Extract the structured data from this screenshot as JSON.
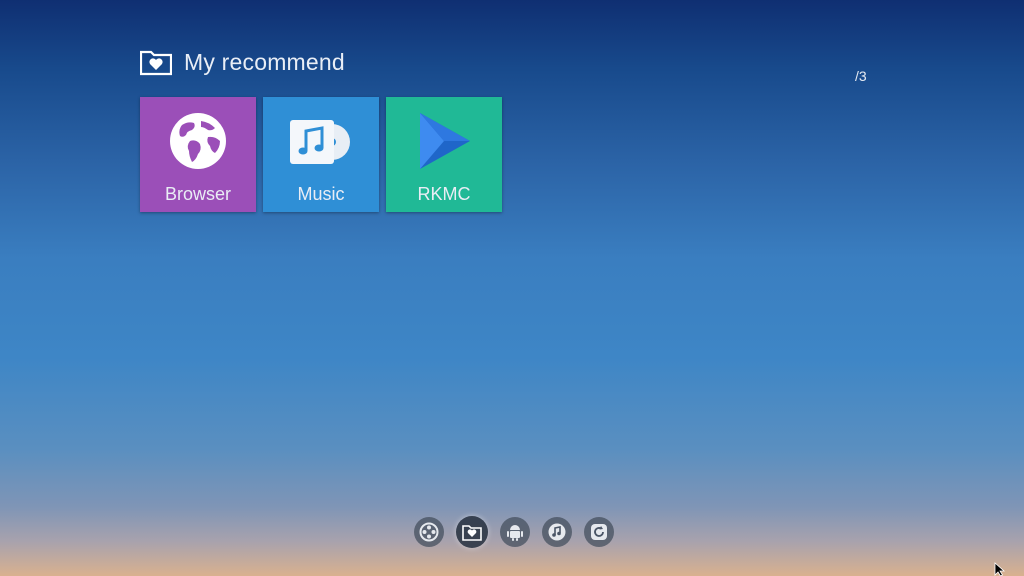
{
  "header": {
    "title": "My recommend",
    "icon": "folder-heart-icon",
    "page_indicator": "/3"
  },
  "tiles": [
    {
      "label": "Browser",
      "icon": "globe-icon",
      "color": "#9b4fb8"
    },
    {
      "label": "Music",
      "icon": "music-disc-icon",
      "color": "#2f8fd6"
    },
    {
      "label": "RKMC",
      "icon": "play-triangle-icon",
      "color": "#20b996"
    }
  ],
  "dock": [
    {
      "icon": "film-reel-icon",
      "active": false
    },
    {
      "icon": "folder-heart-icon",
      "active": true
    },
    {
      "icon": "android-icon",
      "active": false
    },
    {
      "icon": "music-note-icon",
      "active": false
    },
    {
      "icon": "refresh-icon",
      "active": false
    }
  ],
  "colors": {
    "sky_top": "#0f2f72",
    "sky_mid": "#3e86c6",
    "horizon": "#d9b18f"
  }
}
